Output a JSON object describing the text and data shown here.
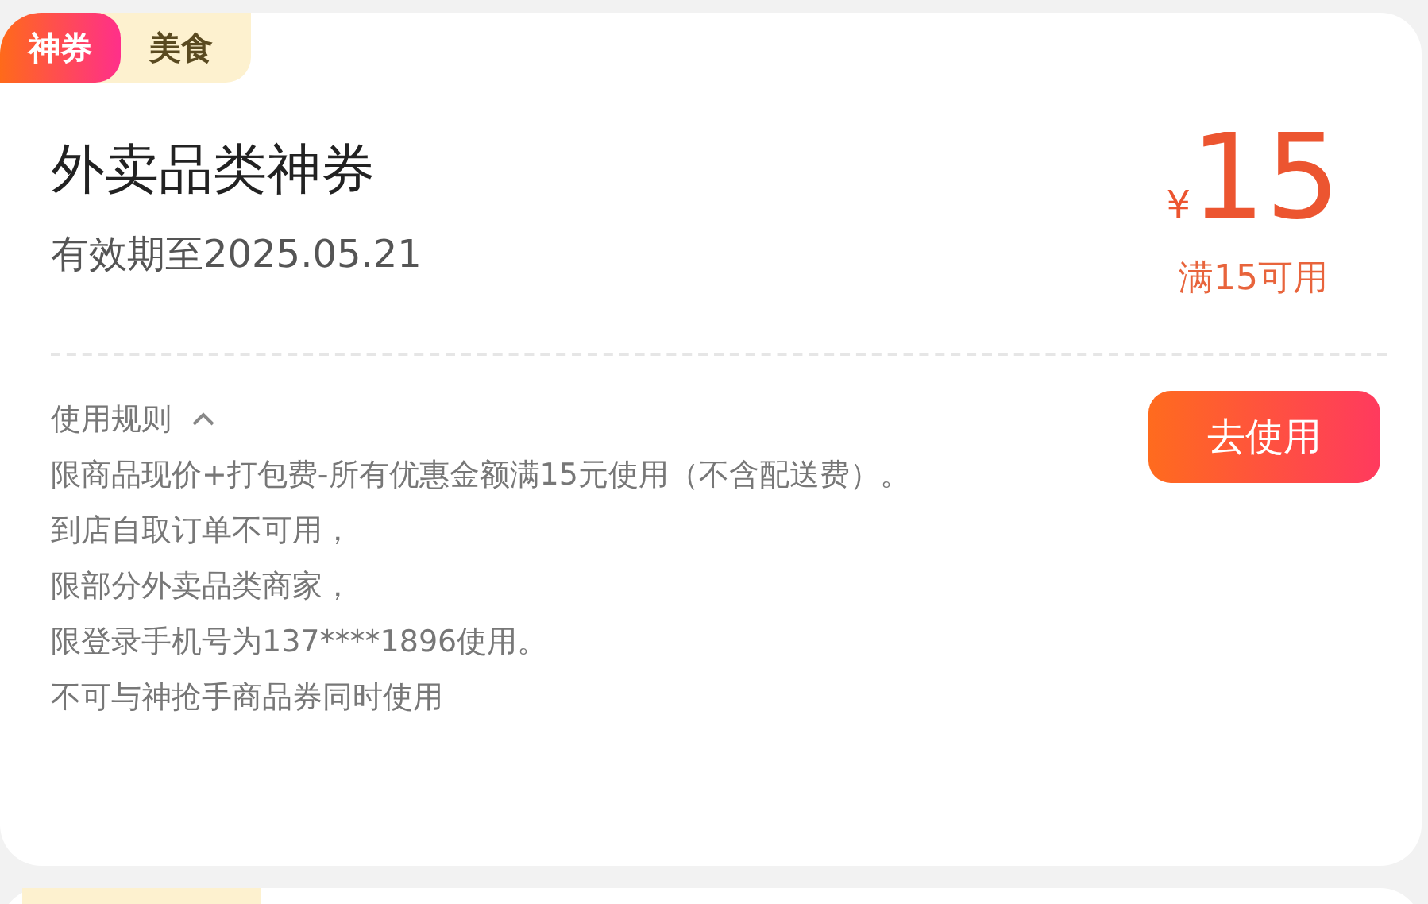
{
  "coupon": {
    "tags": [
      {
        "label": "神券",
        "kind": "highlight"
      },
      {
        "label": "美食",
        "kind": "category"
      }
    ],
    "title": "外卖品类神券",
    "validity": "有效期至2025.05.21",
    "currency": "¥",
    "amount": "15",
    "condition": "满15可用",
    "button": "去使用",
    "rules": {
      "label": "使用规则",
      "expanded": true,
      "lines": [
        "限商品现价+打包费-所有优惠金额满15元使用（不含配送费）。",
        "到店自取订单不可用，",
        "限部分外卖品类商家，",
        "限登录手机号为137****1896使用。",
        "不可与神抢手商品券同时使用"
      ]
    }
  }
}
